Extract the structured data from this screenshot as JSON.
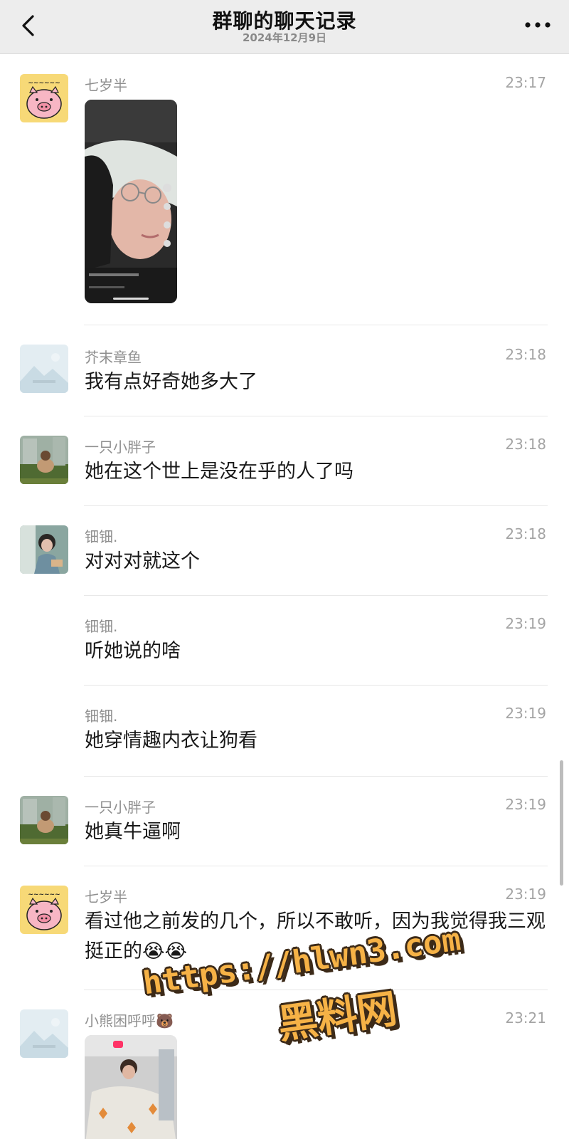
{
  "header": {
    "title": "群聊的聊天记录",
    "date": "2024年12月9日",
    "back_icon": "chevron-left-icon",
    "more_icon": "more-dots-icon",
    "background": "#ededed"
  },
  "messages": [
    {
      "sender": "七岁半",
      "time": "23:17",
      "type": "video",
      "avatar": "pig-sticker"
    },
    {
      "sender": "芥末章鱼",
      "time": "23:18",
      "text": "我有点好奇她多大了",
      "avatar": "landscape-placeholder"
    },
    {
      "sender": "一只小胖子",
      "time": "23:18",
      "text": "她在这个世上是没在乎的人了吗",
      "avatar": "outdoor-photo"
    },
    {
      "sender": "钿钿.",
      "time": "23:18",
      "text": "对对对就这个",
      "avatar": "girl-photo"
    },
    {
      "sender": "钿钿.",
      "time": "23:19",
      "text": "听她说的啥"
    },
    {
      "sender": "钿钿.",
      "time": "23:19",
      "text": "她穿情趣内衣让狗看"
    },
    {
      "sender": "一只小胖子",
      "time": "23:19",
      "text": "她真牛逼啊",
      "avatar": "outdoor-photo"
    },
    {
      "sender": "七岁半",
      "time": "23:19",
      "text": "看过他之前发的几个，所以不敢听，因为我觉得我三观挺正的😭😭",
      "avatar": "pig-sticker"
    },
    {
      "sender": "小熊困呼呼🐻",
      "time": "23:21",
      "type": "video",
      "avatar": "landscape-placeholder"
    }
  ],
  "watermark": {
    "line1": "https://hlwn3.com",
    "line2": "黑料网",
    "color": "#f6b246"
  }
}
